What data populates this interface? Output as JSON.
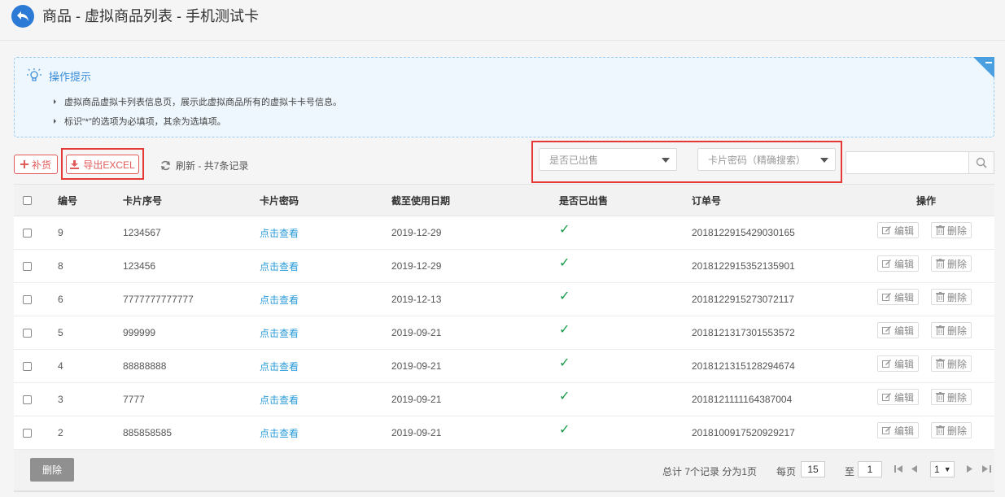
{
  "header": {
    "title": "商品 - 虚拟商品列表 - 手机测试卡"
  },
  "tips": {
    "title": "操作提示",
    "lines": [
      "虚拟商品虚拟卡列表信息页，展示此虚拟商品所有的虚拟卡卡号信息。",
      "标识“*”的选项为必填项，其余为选填项。"
    ]
  },
  "toolbar": {
    "add_label": "补货",
    "export_label": "导出EXCEL",
    "refresh_label": "刷新 - 共7条记录",
    "sold_filter_placeholder": "是否已出售",
    "password_filter_placeholder": "卡片密码（精确搜索）",
    "search_value": ""
  },
  "table": {
    "columns": [
      "编号",
      "卡片序号",
      "卡片密码",
      "截至使用日期",
      "是否已出售",
      "订单号",
      "操作"
    ],
    "rows": [
      {
        "id": "9",
        "serial": "1234567",
        "password": "点击查看",
        "date": "2019-12-29",
        "sold": "✓",
        "order": "2018122915429030165",
        "edit": "编辑",
        "delete": "删除"
      },
      {
        "id": "8",
        "serial": "123456",
        "password": "点击查看",
        "date": "2019-12-29",
        "sold": "✓",
        "order": "2018122915352135901",
        "edit": "编辑",
        "delete": "删除"
      },
      {
        "id": "6",
        "serial": "7777777777777",
        "password": "点击查看",
        "date": "2019-12-13",
        "sold": "✓",
        "order": "2018122915273072117",
        "edit": "编辑",
        "delete": "删除"
      },
      {
        "id": "5",
        "serial": "999999",
        "password": "点击查看",
        "date": "2019-09-21",
        "sold": "✓",
        "order": "2018121317301553572",
        "edit": "编辑",
        "delete": "删除"
      },
      {
        "id": "4",
        "serial": "88888888",
        "password": "点击查看",
        "date": "2019-09-21",
        "sold": "✓",
        "order": "2018121315128294674",
        "edit": "编辑",
        "delete": "删除"
      },
      {
        "id": "3",
        "serial": "7777",
        "password": "点击查看",
        "date": "2019-09-21",
        "sold": "✓",
        "order": "2018121111164387004",
        "edit": "编辑",
        "delete": "删除"
      },
      {
        "id": "2",
        "serial": "885858585",
        "password": "点击查看",
        "date": "2019-09-21",
        "sold": "✓",
        "order": "2018100917520929217",
        "edit": "编辑",
        "delete": "删除"
      }
    ]
  },
  "footer": {
    "delete_label": "删除",
    "summary": "总计 7个记录 分为1页",
    "per_page_label": "每页",
    "per_page_value": "15",
    "goto_label": "至",
    "goto_value": "1",
    "page_select": "1"
  },
  "colors": {
    "accent": "#2a9bd8",
    "danger": "#e25b5b",
    "success": "#1a9a4a",
    "highlight_frame": "#e53935"
  }
}
